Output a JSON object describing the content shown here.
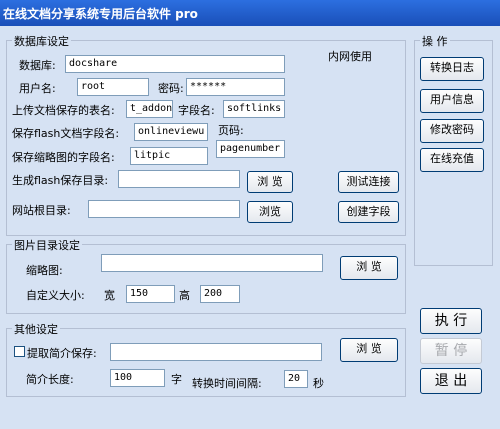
{
  "window": {
    "title": "在线文档分享系统专用后台软件 pro"
  },
  "database": {
    "legend": "数据库设定",
    "network_note": "内网使用",
    "db_label": "数据库:",
    "db_value": "docshare",
    "user_label": "用户名:",
    "user_value": "root",
    "pwd_label": "密码:",
    "pwd_value": "******",
    "table_label": "上传文档保存的表名:",
    "table_value": "t_addon",
    "field_label": "字段名:",
    "field_value": "softlinks",
    "flash_field_label": "保存flash文档字段名:",
    "flash_field_value": "onlineviewu",
    "page_label": "页码:",
    "page_value": "pagenumber",
    "thumb_field_label": "保存缩略图的字段名:",
    "thumb_field_value": "litpic",
    "flash_dir_label": "生成flash保存目录:",
    "flash_dir_value": "",
    "root_dir_label": "网站根目录:",
    "root_dir_value": "",
    "browse1_label": "浏 览",
    "browse2_label": "浏览",
    "test_label": "测试连接",
    "create_label": "创建字段"
  },
  "image": {
    "legend": "图片目录设定",
    "thumb_label": "缩略图:",
    "thumb_value": "",
    "browse_label": "浏 览",
    "size_label": "自定义大小:",
    "width_label": "宽",
    "width_value": "150",
    "height_label": "高",
    "height_value": "200"
  },
  "other": {
    "legend": "其他设定",
    "extract_label": "提取简介保存:",
    "extract_value": "",
    "browse_label": "浏 览",
    "length_label": "简介长度:",
    "length_value": "100",
    "char_unit": "字",
    "interval_label": "转换时间间隔:",
    "interval_value": "20",
    "sec_unit": "秒"
  },
  "actions": {
    "legend": "操 作",
    "log": "转换日志",
    "userinfo": "用户信息",
    "changepwd": "修改密码",
    "recharge": "在线充值",
    "run": "执 行",
    "pause": "暂 停",
    "exit": "退 出"
  }
}
